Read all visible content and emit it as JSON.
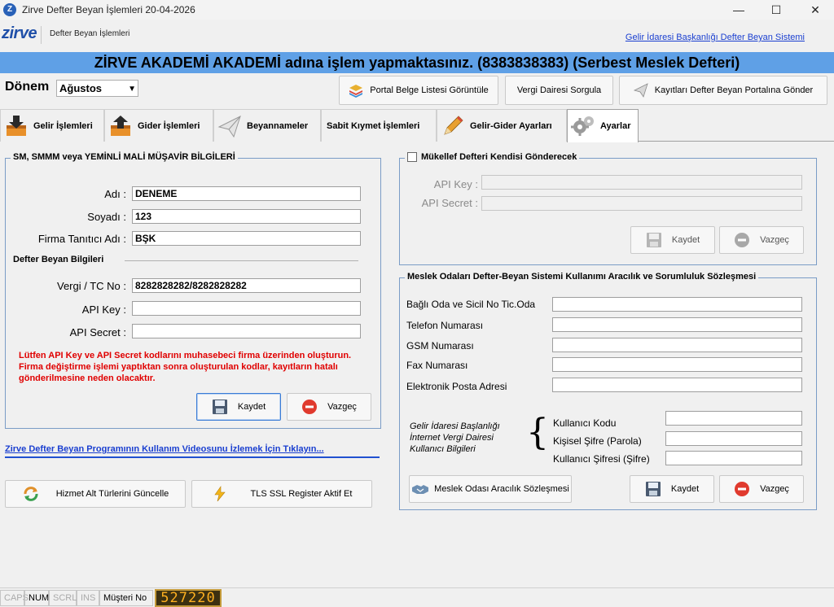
{
  "window": {
    "title": "Zirve Defter Beyan İşlemleri 20-04-2026",
    "minimize": "—",
    "maximize": "☐",
    "close": "✕"
  },
  "header": {
    "logo": "zirve",
    "module": "Defter Beyan İşlemleri",
    "gib_link": "Gelir İdaresi Başkanlığı Defter Beyan Sistemi"
  },
  "banner": "ZİRVE AKADEMİ AKADEMİ adına işlem yapmaktasınız. (8383838383) (Serbest Meslek Defteri)",
  "period": {
    "label": "Dönem",
    "value": "Ağustos"
  },
  "toolbar": {
    "portal_list": "Portal Belge Listesi Görüntüle",
    "tax_office": "Vergi Dairesi Sorgula",
    "send": "Kayıtları Defter Beyan Portalına Gönder"
  },
  "tabs": [
    {
      "label": "Gelir İşlemleri",
      "icon": "income-icon"
    },
    {
      "label": "Gider İşlemleri",
      "icon": "expense-icon"
    },
    {
      "label": "Beyannameler",
      "icon": "paper-plane-icon"
    },
    {
      "label": "Sabit Kıymet İşlemleri",
      "icon": ""
    },
    {
      "label": "Gelir-Gider Ayarları",
      "icon": "pencil-icon"
    },
    {
      "label": "Ayarlar",
      "icon": "gears-icon"
    }
  ],
  "smmm": {
    "title": "SM, SMMM veya YEMİNLİ MALİ MÜŞAVİR BİLGİLERİ",
    "fields": [
      {
        "label": "Adı  :",
        "value": "DENEME"
      },
      {
        "label": "Soyadı :",
        "value": "123"
      },
      {
        "label": "Firma Tanıtıcı Adı :",
        "value": "BŞK"
      }
    ],
    "sub_title": "Defter Beyan Bilgileri",
    "db_fields": [
      {
        "label": "Vergi / TC No :",
        "value": "8282828282/8282828282"
      },
      {
        "label": "API Key :",
        "value": ""
      },
      {
        "label": "API Secret :",
        "value": ""
      }
    ],
    "warning": "Lütfen API Key ve API Secret kodlarını muhasebeci firma üzerinden oluşturun. Firma değiştirme işlemi yaptıktan sonra oluşturulan kodlar, kayıtların hatalı gönderilmesine neden olacaktır.",
    "save": "Kaydet",
    "cancel": "Vazgeç"
  },
  "video_link": "Zirve Defter Beyan Programının Kullanım Videosunu İzlemek İçin Tıklayın...",
  "bottom_buttons": {
    "update_types": "Hizmet Alt Türlerini Güncelle",
    "tls": "TLS SSL Register Aktif Et"
  },
  "taxpayer": {
    "title": "Mükellef Defteri Kendisi Gönderecek",
    "checked": false,
    "api_key": "API Key :",
    "api_secret": "API Secret :",
    "save": "Kaydet",
    "cancel": "Vazgeç"
  },
  "chamber": {
    "title": "Meslek Odaları Defter-Beyan Sistemi Kullanımı Aracılık ve Sorumluluk Sözleşmesi",
    "fields": [
      {
        "label": "Bağlı Oda ve Sicil No Tic.Oda",
        "value": ""
      },
      {
        "label": "Telefon Numarası",
        "value": ""
      },
      {
        "label": "GSM Numarası",
        "value": ""
      },
      {
        "label": "Fax Numarası",
        "value": ""
      },
      {
        "label": "Elektronik Posta Adresi",
        "value": ""
      }
    ],
    "gib_note": [
      "Gelir İdaresi Başlanlığı",
      "İnternet Vergi Dairesi",
      "Kullanıcı Bilgileri"
    ],
    "brace": "{",
    "user_fields": [
      {
        "label": "Kullanıcı Kodu",
        "value": ""
      },
      {
        "label": "Kişisel Şifre (Parola)",
        "value": ""
      },
      {
        "label": "Kullanıcı Şifresi (Şifre)",
        "value": ""
      }
    ],
    "agreement": "Meslek Odası Aracılık Sözleşmesi",
    "save": "Kaydet",
    "cancel": "Vazgeç"
  },
  "statusbar": {
    "caps": "CAPS",
    "num": "NUM",
    "scrl": "SCRL",
    "ins": "INS",
    "customer_label": "Müşteri No",
    "customer_no": "527220"
  }
}
